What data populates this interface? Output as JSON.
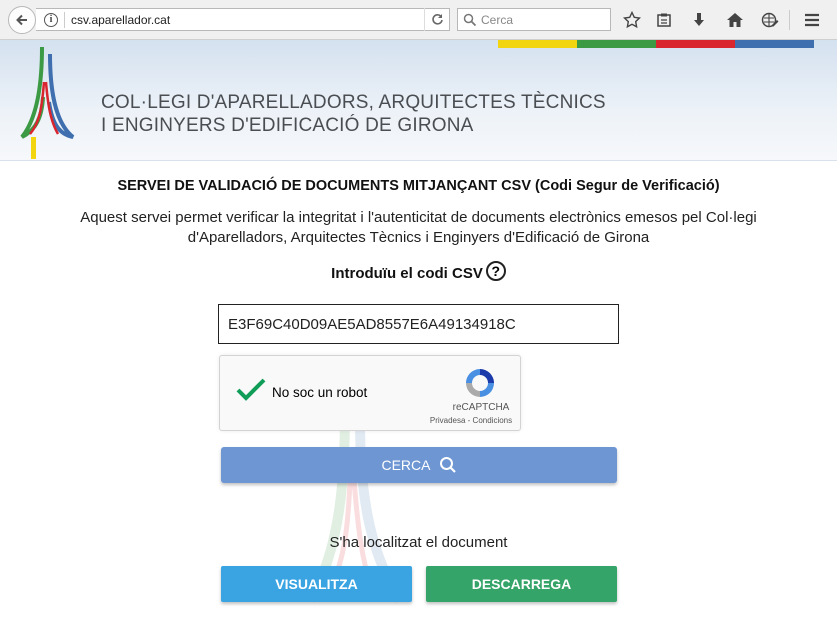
{
  "browser": {
    "url": "csv.aparellador.cat",
    "search_placeholder": "Cerca"
  },
  "header": {
    "org_line1": "COL·LEGI D'APARELLADORS, ARQUITECTES TÈCNICS",
    "org_line2": "I ENGINYERS D'EDIFICACIÓ DE GIRONA",
    "stripe_colors": [
      "#f2d50e",
      "#3c9a45",
      "#d9262e",
      "#3f6fae"
    ]
  },
  "main": {
    "title": "SERVEI DE VALIDACIÓ DE DOCUMENTS MITJANÇANT CSV (Codi Segur de Verificació)",
    "description": "Aquest servei permet verificar la integritat i l'autenticitat de documents electrònics emesos pel Col·legi d'Aparelladors, Arquitectes Tècnics i Enginyers d'Edificació de Girona",
    "csv_label": "Introduïu el codi CSV",
    "help_symbol": "?",
    "csv_value": "E3F69C40D09AE5AD8557E6A49134918C",
    "recaptcha": {
      "label": "No soc un robot",
      "brand": "reCAPTCHA",
      "terms": "Privadesa - Condicions",
      "checked": true
    },
    "search_button": "CERCA",
    "status_message": "S'ha localitzat el document",
    "view_button": "VISUALITZA",
    "download_button": "DESCARREGA"
  }
}
